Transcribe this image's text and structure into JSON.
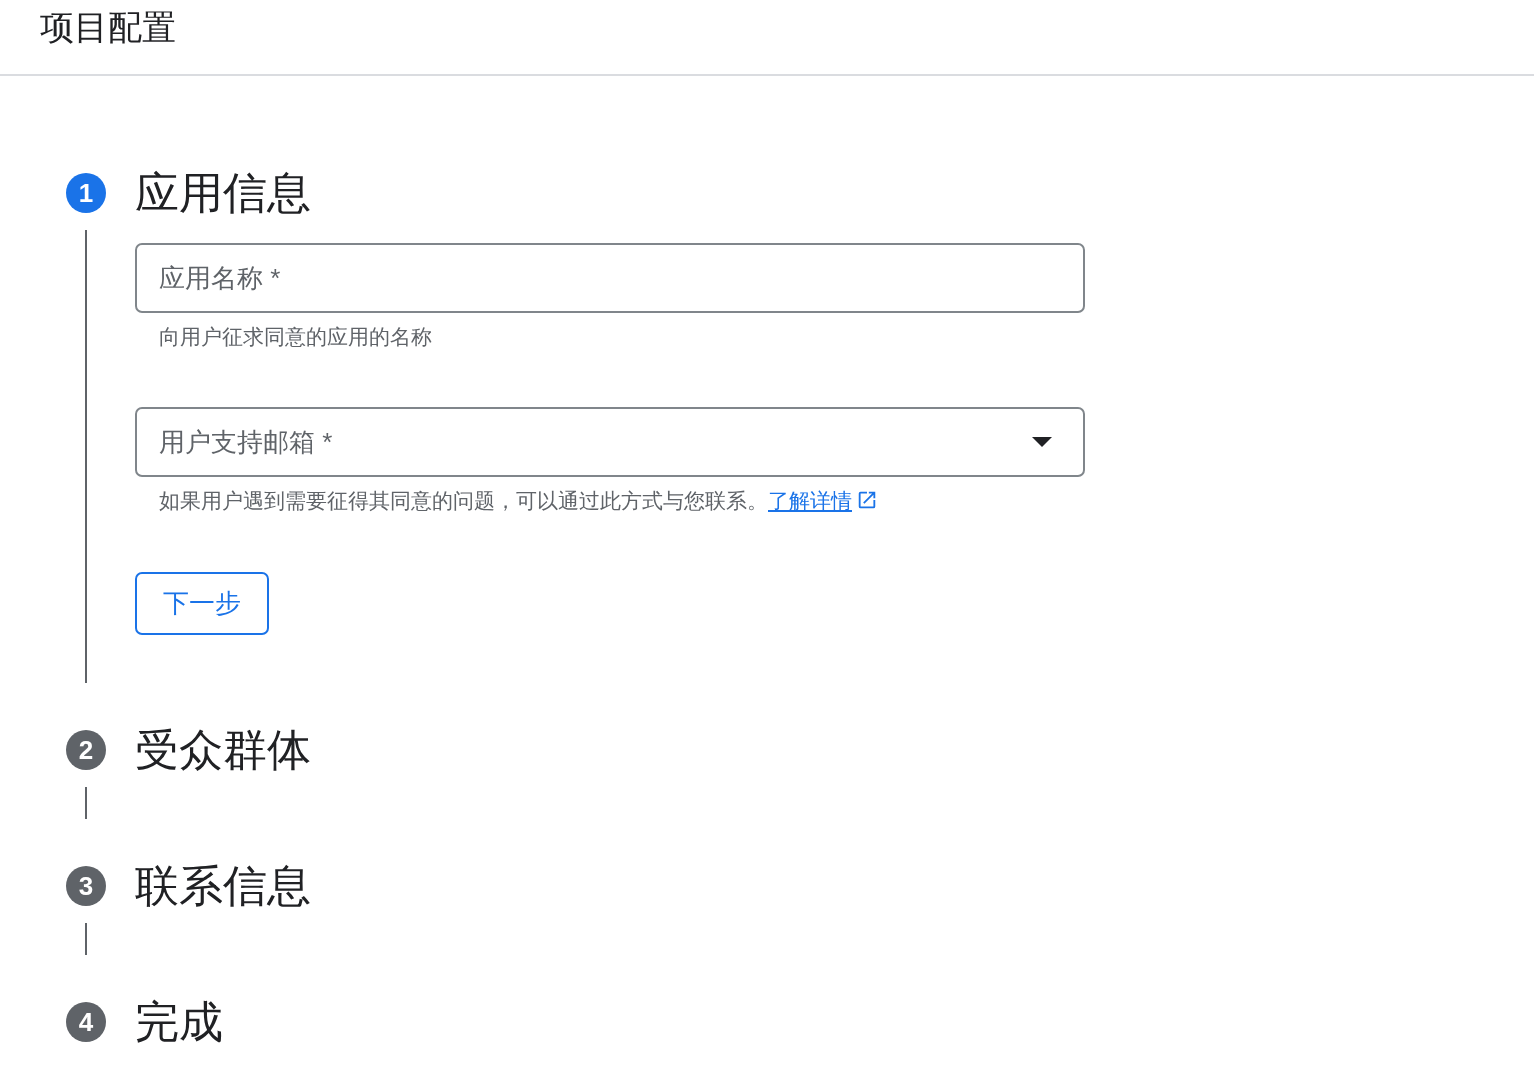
{
  "header": {
    "title": "项目配置"
  },
  "steps": [
    {
      "number": "1",
      "title": "应用信息",
      "selected": true,
      "fields": [
        {
          "kind": "text",
          "placeholder": "应用名称 *",
          "helper": "向用户征求同意的应用的名称"
        },
        {
          "kind": "select",
          "placeholder": "用户支持邮箱 *",
          "helper": "如果用户遇到需要征得其同意的问题，可以通过此方式与您联系。",
          "link": "了解详情"
        }
      ],
      "button": "下一步"
    },
    {
      "number": "2",
      "title": "受众群体",
      "selected": false
    },
    {
      "number": "3",
      "title": "联系信息",
      "selected": false
    },
    {
      "number": "4",
      "title": "完成",
      "selected": false
    }
  ]
}
